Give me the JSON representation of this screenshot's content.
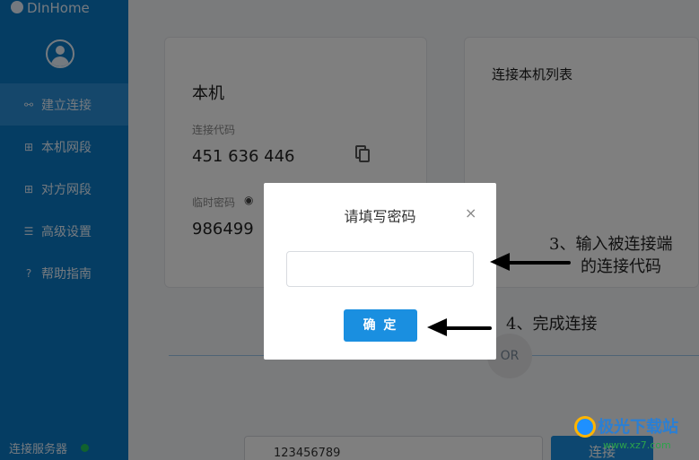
{
  "app": {
    "name": "DInHome"
  },
  "sidebar": {
    "items": [
      {
        "label": "建立连接",
        "icon": "link-icon",
        "active": true
      },
      {
        "label": "本机网段",
        "icon": "network-icon",
        "active": false
      },
      {
        "label": "对方网段",
        "icon": "network-icon",
        "active": false
      },
      {
        "label": "高级设置",
        "icon": "sliders-icon",
        "active": false
      },
      {
        "label": "帮助指南",
        "icon": "help-icon",
        "active": false
      }
    ],
    "server_label": "连接服务器",
    "server_status_color": "#22c55e"
  },
  "local": {
    "title": "本机",
    "code_label": "连接代码",
    "code_value": "451 636 446",
    "temp_pwd_label": "临时密码",
    "temp_pwd_value": "986499"
  },
  "list": {
    "title": "连接本机列表"
  },
  "divider": {
    "or_label": "OR"
  },
  "connect": {
    "input_value": "123456789",
    "button_label": "连接"
  },
  "modal": {
    "title": "请填写密码",
    "close_glyph": "×",
    "password_value": "",
    "ok_label": "确 定"
  },
  "annotations": {
    "step3_line1": "3、输入被连接端",
    "step3_line2": "的连接代码",
    "step4": "4、完成连接"
  },
  "watermark": {
    "text1": "极光下载站",
    "text2": "www.xz7.com"
  },
  "colors": {
    "sidebar": "#0a7ac7",
    "accent": "#1a8fe0"
  }
}
